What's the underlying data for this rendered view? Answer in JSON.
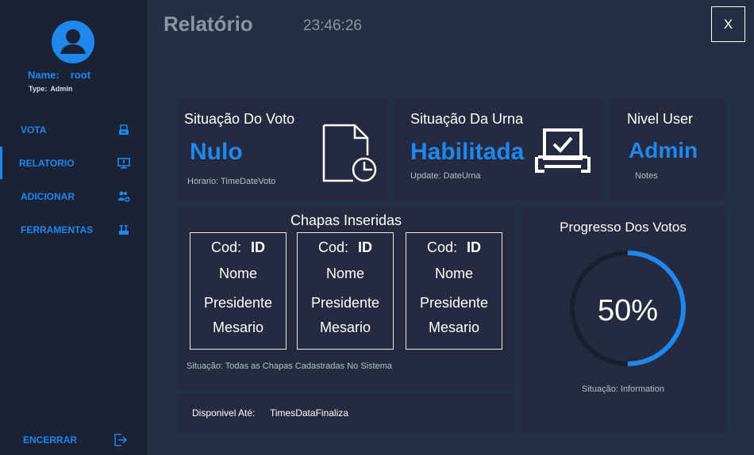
{
  "user": {
    "name_label": "Name:",
    "name_value": "root",
    "type_label": "Type:",
    "type_value": "Admin"
  },
  "nav": {
    "items": [
      {
        "label": "VOTA",
        "icon": "ballot-box-icon"
      },
      {
        "label": "RELATORIO",
        "icon": "monitor-icon"
      },
      {
        "label": "ADICIONAR",
        "icon": "add-users-icon"
      },
      {
        "label": "FERRAMENTAS",
        "icon": "tools-icon"
      }
    ],
    "active": "RELATORIO",
    "exit_label": "ENCERRAR"
  },
  "header": {
    "title": "Relatório",
    "time": "23:46:26",
    "close_label": "X"
  },
  "cards": {
    "voto": {
      "title": "Situação Do Voto",
      "value": "Nulo",
      "note": "Horario: TimeDateVoto"
    },
    "urna": {
      "title": "Situação Da Urna",
      "value": "Habilitada",
      "note": "Update: DateUrna"
    },
    "nivel": {
      "title": "Nivel User",
      "value": "Admin",
      "note": "Notes"
    },
    "chapas": {
      "title": "Chapas Inseridas",
      "items": [
        {
          "cod_label": "Cod:",
          "cod_id": "ID",
          "nome": "Nome",
          "presidente": "Presidente",
          "mesario": "Mesario"
        },
        {
          "cod_label": "Cod:",
          "cod_id": "ID",
          "nome": "Nome",
          "presidente": "Presidente",
          "mesario": "Mesario"
        },
        {
          "cod_label": "Cod:",
          "cod_id": "ID",
          "nome": "Nome",
          "presidente": "Presidente",
          "mesario": "Mesario"
        }
      ],
      "note": "Situação: Todas as Chapas Cadastradas No Sistema"
    },
    "disponivel": {
      "label": "Disponivel Até:",
      "value": "TimesDataFinaliza"
    },
    "progresso": {
      "title": "Progresso Dos Votos",
      "percent_text": "50%",
      "percent": 50,
      "note": "Situação: Information"
    }
  },
  "colors": {
    "accent": "#1e88ee",
    "background": "#223043",
    "sidebar": "#1b2236",
    "card": "#252a40",
    "ring_track": "#1a1f30"
  }
}
